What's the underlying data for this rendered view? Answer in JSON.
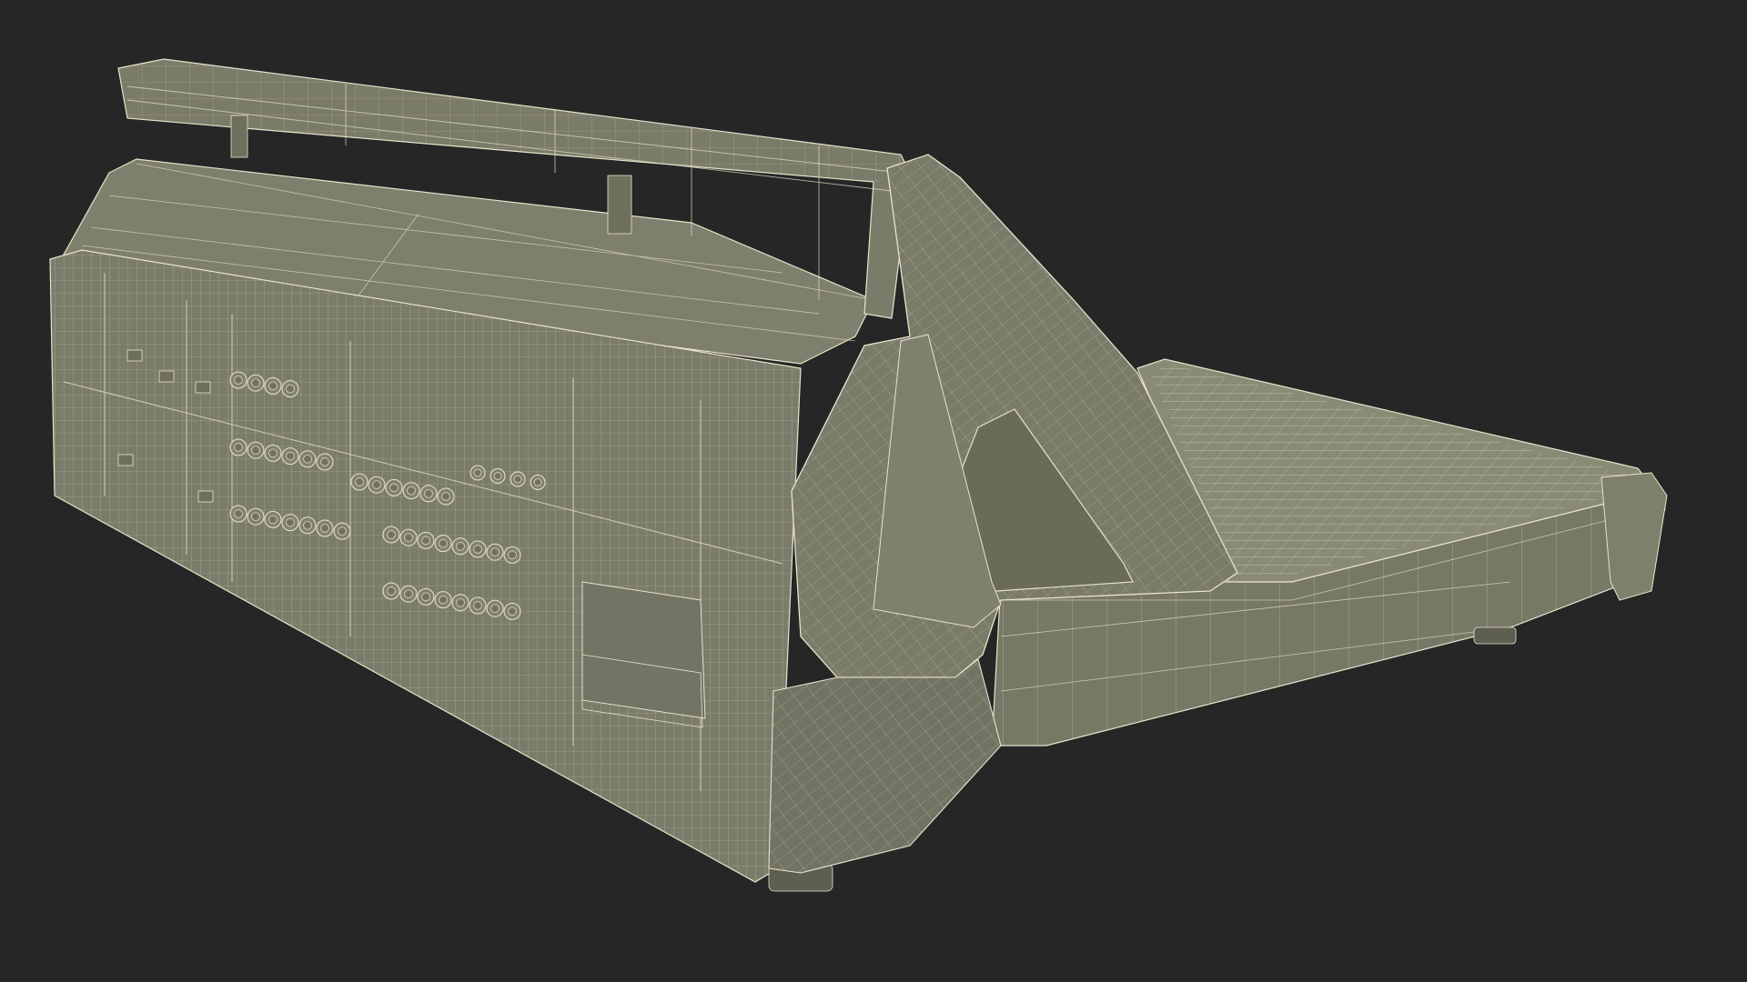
{
  "scene": {
    "background_color": "#262626",
    "model_fill_color": "#7b7c6a",
    "model_shadow_color": "#5e5f50",
    "model_highlight_color": "#8b8c78",
    "wireframe_color": "#e6e4cc",
    "subject": "mixing-console-wireframe-render"
  }
}
